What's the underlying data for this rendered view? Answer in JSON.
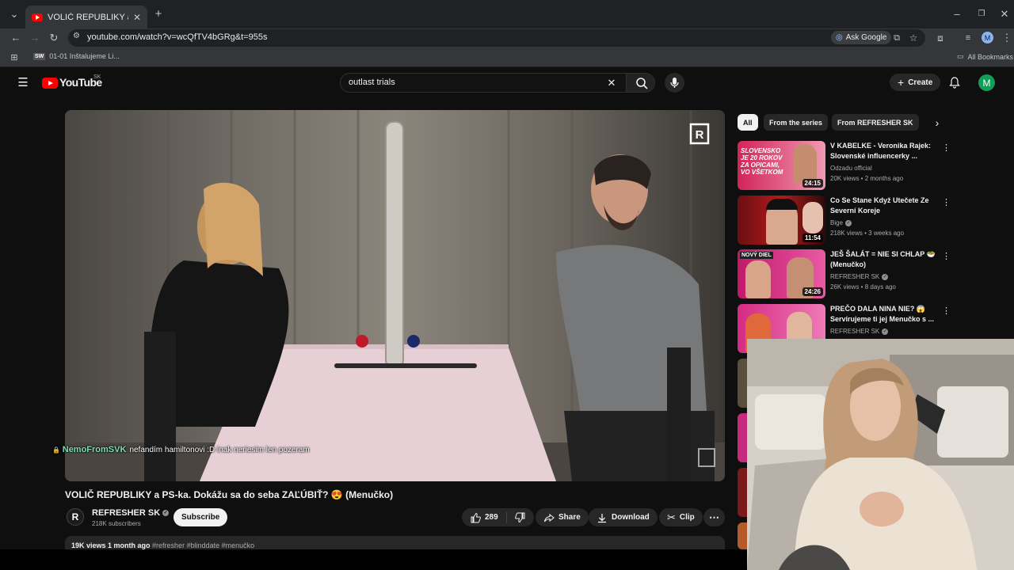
{
  "browser": {
    "tab_title": "VOLIČ REPUBLIKY a PS-ka. Dok",
    "url": "youtube.com/watch?v=wcQfTV4bGRg&t=955s",
    "ask_google": "Ask Google",
    "bookmark": "01-01 Inštalujeme Li...",
    "bookmark_icon": "SW",
    "all_bookmarks": "All Bookmarks",
    "profile_letter": "M"
  },
  "header": {
    "logo_text": "YouTube",
    "logo_country": "SK",
    "search_value": "outlast trials",
    "create_label": "Create",
    "avatar_letter": "M"
  },
  "video": {
    "chat_user": "NemoFromSVK",
    "chat_message": "nefandím hamiltonovi :D inak neriesim len pozeram",
    "title": "VOLIČ REPUBLIKY a PS-ka. Dokážu sa do seba ZAĽÚBIŤ? 😍 (Menučko)",
    "channel_logo": "R",
    "channel_name": "REFRESHER SK",
    "subscribers": "218K subscribers",
    "subscribe_label": "Subscribe",
    "like_count": "289",
    "share_label": "Share",
    "download_label": "Download",
    "clip_label": "Clip",
    "description": "19K views  1 month ago",
    "hashtags": "#refresher #blinddate #menučko"
  },
  "sidebar": {
    "chips": [
      "All",
      "From the series",
      "From REFRESHER SK"
    ],
    "recommendations": [
      {
        "title": "V KABELKE - Veronika Rajek: Slovenské influencerky ...",
        "channel": "Odzadu official",
        "meta": "20K views • 2 months ago",
        "duration": "24:15",
        "thumb_text": "SLOVENSKO JE 20 ROKOV ZA OPICAMI, VO VŠETKOM",
        "verified": false
      },
      {
        "title": "Co Se Stane Když Utečete Ze Severní Koreje",
        "channel": "Bige",
        "meta": "218K views • 3 weeks ago",
        "duration": "11:54",
        "thumb_text": "",
        "verified": true
      },
      {
        "title": "JEŠ ŠALÁT = NIE SI CHLAP 🥗 (Menučko)",
        "channel": "REFRESHER SK",
        "meta": "26K views • 8 days ago",
        "duration": "24:26",
        "thumb_text": "NOVÝ DIEL",
        "verified": true
      },
      {
        "title": "PREČO DALA NINA NIE? 😱 Servírujeme ti jej Menučko s ...",
        "channel": "REFRESHER SK",
        "meta": "",
        "duration": "",
        "thumb_text": "",
        "verified": true
      }
    ]
  },
  "colors": {
    "yt_red": "#ff0000",
    "background": "#0f0f0f",
    "pill": "#272727"
  }
}
